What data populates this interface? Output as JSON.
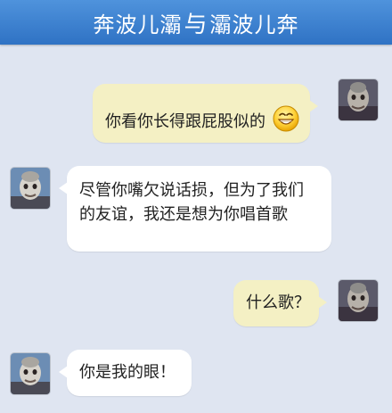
{
  "header": {
    "title_left": "奔波儿灞",
    "title_join": "与",
    "title_right": "灞波儿奔"
  },
  "messages": [
    {
      "side": "right",
      "text": "你看你长得跟屁股似的",
      "emoji": "grinning-emoji"
    },
    {
      "side": "left",
      "text": "尽管你嘴欠说话损，但为了我们的友谊，我还是想为你唱首歌"
    },
    {
      "side": "right",
      "text": "什么歌？"
    },
    {
      "side": "left",
      "text": "你是我的眼！"
    }
  ],
  "colors": {
    "header": "#3b80d0",
    "background": "#dfe5f1",
    "bubble_right": "#f4f0c4",
    "bubble_left": "#ffffff"
  }
}
